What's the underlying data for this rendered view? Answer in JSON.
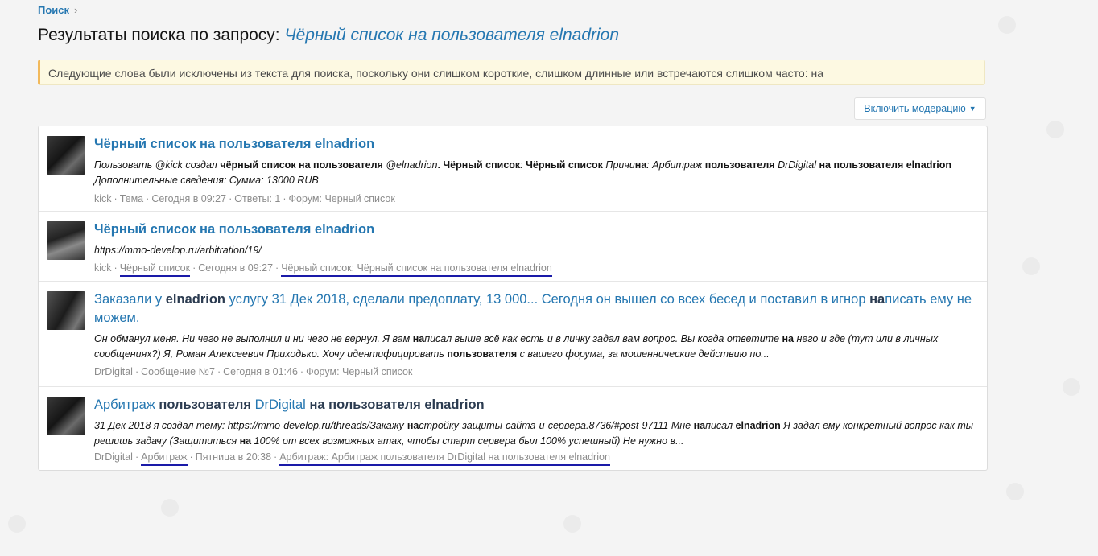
{
  "breadcrumb": {
    "label": "Поиск"
  },
  "page": {
    "title_prefix": "Результаты поиска по запросу: ",
    "query": "Чёрный список на пользователя elnadrion"
  },
  "notice": "Следующие слова были исключены из текста для поиска, поскольку они слишком короткие, слишком длинные или встречаются слишком часто: на",
  "moderation_button": "Включить модерацию",
  "results": [
    {
      "title": "Чёрный список на пользователя elnadrion",
      "snippet_line1": [
        {
          "t": "Пользовать @kick создал ",
          "b": false
        },
        {
          "t": "чёрный список на пользователя",
          "b": true
        },
        {
          "t": " @elnadrion",
          "b": false
        },
        {
          "t": ". Чёрный список",
          "b": true
        },
        {
          "t": ": ",
          "b": false
        },
        {
          "t": "Чёрный список",
          "b": true
        },
        {
          "t": " Причи",
          "b": false
        },
        {
          "t": "на",
          "b": true
        },
        {
          "t": ": Арбитраж ",
          "b": false
        },
        {
          "t": "пользователя",
          "b": true
        },
        {
          "t": " DrDigital ",
          "b": false
        },
        {
          "t": "на пользователя elnadrion",
          "b": true
        }
      ],
      "snippet_line2": "Дополнительные сведения: Сумма: 13000 RUB",
      "meta": {
        "author": "kick",
        "type": "Тема",
        "date": "Сегодня в 09:27",
        "replies": "Ответы: 1",
        "forum": "Форум: Черный список"
      }
    },
    {
      "title": "Чёрный список на пользователя elnadrion",
      "snippet": "https://mmo-develop.ru/arbitration/19/",
      "meta": {
        "author": "kick",
        "category": "Чёрный список",
        "date": "Сегодня в 09:27",
        "link": "Чёрный список: Чёрный список на пользователя elnadrion"
      }
    },
    {
      "title_parts": [
        {
          "t": "Заказали у ",
          "b": false
        },
        {
          "t": "elnadrion",
          "b": true
        },
        {
          "t": " услугу 31 Дек 2018, сделали предоплату, 13 000... Сегодня он вышел со всех бесед и поставил в игнор ",
          "b": false
        },
        {
          "t": "на",
          "b": true
        },
        {
          "t": "писать ему не можем.",
          "b": false
        }
      ],
      "snippet_parts": [
        {
          "t": "Он обманул меня. Ни чего не выполнил и ни чего не вернул. Я вам ",
          "b": false
        },
        {
          "t": "на",
          "b": true
        },
        {
          "t": "писал выше всё как есть и в личку задал вам вопрос. Вы когда ответите ",
          "b": false
        },
        {
          "t": "на",
          "b": true
        },
        {
          "t": " него и где (тут или в личных сообщениях?) Я, Роман Алексеевич Приходько. Хочу идентифицировать ",
          "b": false
        },
        {
          "t": "пользователя",
          "b": true
        },
        {
          "t": " с вашего форума, за мошеннические действию по...",
          "b": false
        }
      ],
      "meta": {
        "author": "DrDigital",
        "type": "Сообщение №7",
        "date": "Сегодня в 01:46",
        "forum": "Форум: Черный список"
      }
    },
    {
      "title_parts": [
        {
          "t": "Арбитраж ",
          "b": false
        },
        {
          "t": "пользователя",
          "b": true
        },
        {
          "t": " DrDigital ",
          "b": false
        },
        {
          "t": "на пользователя elnadrion",
          "b": true
        }
      ],
      "snippet_parts": [
        {
          "t": "31 Дек 2018 я создал тему: https://mmo-develop.ru/threads/Закажу-",
          "b": false
        },
        {
          "t": "на",
          "b": true
        },
        {
          "t": "стройку-защиты-сайта-и-сервера.8736/#post-97111 Мне ",
          "b": false
        },
        {
          "t": "на",
          "b": true
        },
        {
          "t": "писал ",
          "b": false
        },
        {
          "t": "elnadrion",
          "b": true
        },
        {
          "t": " Я задал ему конкретный вопрос как ты решишь задачу (Защититься ",
          "b": false
        },
        {
          "t": "на",
          "b": true
        },
        {
          "t": " 100% от всех возможных атак, чтобы старт сервера был 100% успешный) Не нужно в...",
          "b": false
        }
      ],
      "meta": {
        "author": "DrDigital",
        "category": "Арбитраж",
        "date": "Пятница в 20:38",
        "link": "Арбитраж: Арбитраж пользователя DrDigital на пользователя elnadrion"
      }
    }
  ],
  "separator": "·",
  "colors": {
    "link": "#2577b1",
    "meta": "#8c8c8c",
    "notice_bg": "#fdf9e2",
    "annotation": "#1a1aa8"
  }
}
